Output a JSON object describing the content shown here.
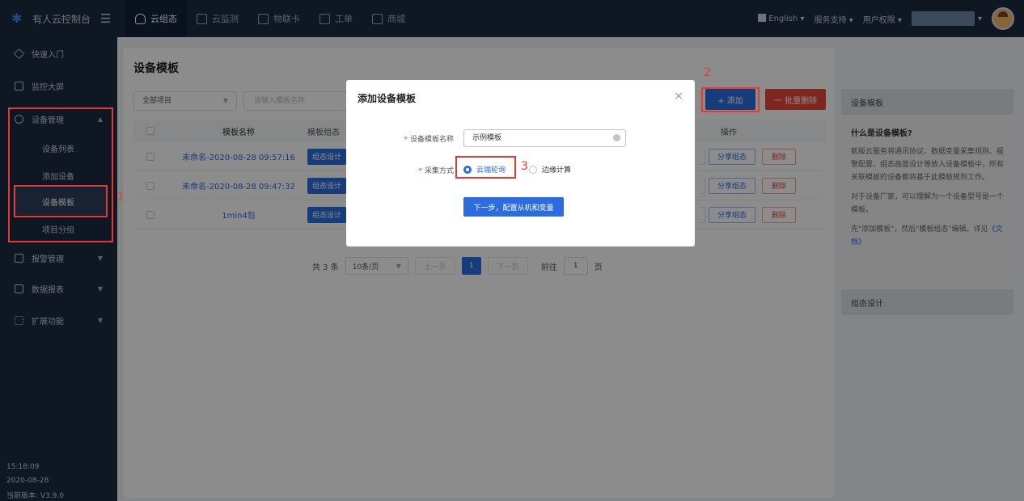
{
  "topbar": {
    "brand": "有人云控制台",
    "nav": [
      "云组态",
      "云监测",
      "物联卡",
      "工单",
      "商城"
    ],
    "language": "English",
    "support": "服务支持",
    "user_perm": "用户权限"
  },
  "sidebar": {
    "items": {
      "quick": "快速入门",
      "screen": "监控大屏",
      "device_mgmt": "设备管理",
      "alarm": "报警管理",
      "report": "数据报表",
      "extend": "扩展功能"
    },
    "sub": [
      "设备列表",
      "添加设备",
      "设备模板",
      "项目分组"
    ],
    "time": "15:18:09",
    "date": "2020-08-28",
    "version": "当前版本: V3.9.0"
  },
  "main": {
    "title": "设备模板",
    "project_select": "全部项目",
    "search_placeholder": "请输入模板名称",
    "add_label": "+ 添加",
    "batch_delete_label": "一 批量删除",
    "table": {
      "headers": {
        "name": "模板名称",
        "design": "模板组态",
        "ops": "操作"
      },
      "rows": [
        {
          "name": "未命名-2020-08-28 09:57:16",
          "design": "组态设计",
          "share": "分享组态",
          "delete": "删除"
        },
        {
          "name": "未命名-2020-08-28 09:47:32",
          "design": "组态设计",
          "share": "分享组态",
          "delete": "删除"
        },
        {
          "name": "1min4包",
          "design": "组态设计",
          "share": "分享组态",
          "delete": "删除"
        }
      ]
    },
    "pager": {
      "total": "共 3 条",
      "size": "10条/页",
      "prev": "上一页",
      "page": "1",
      "next": "下一页",
      "goto_prefix": "前往",
      "goto_value": "1",
      "goto_suffix": "页"
    }
  },
  "help": {
    "header": "设备模板",
    "question": "什么是设备模板?",
    "p1": "新版云服务将通讯协议、数据变量采集规则、报警配置、组态画面设计等放入设备模板中，所有关联模板的设备都将基于此模板规则工作。",
    "p2": "对于设备厂家，可以理解为一个设备型号是一个模板。",
    "p3_prefix": "先\"添加模板\"，然后\"模板组态\"编辑。详见",
    "p3_link": "《文档》",
    "header2": "组态设计"
  },
  "dialog": {
    "title": "添加设备模板",
    "close": "×",
    "name_label": "设备模板名称",
    "name_value": "示例模板",
    "method_label": "采集方式",
    "option_cloud": "云端轮询",
    "option_edge": "边缘计算",
    "next_button": "下一步，配置从机和变量"
  },
  "annotations": [
    "1",
    "2",
    "3"
  ],
  "colors": {
    "primary": "#2d6cdf",
    "danger": "#e8453c",
    "nav_bg": "#1c2a3f",
    "annotation": "#e53935"
  }
}
